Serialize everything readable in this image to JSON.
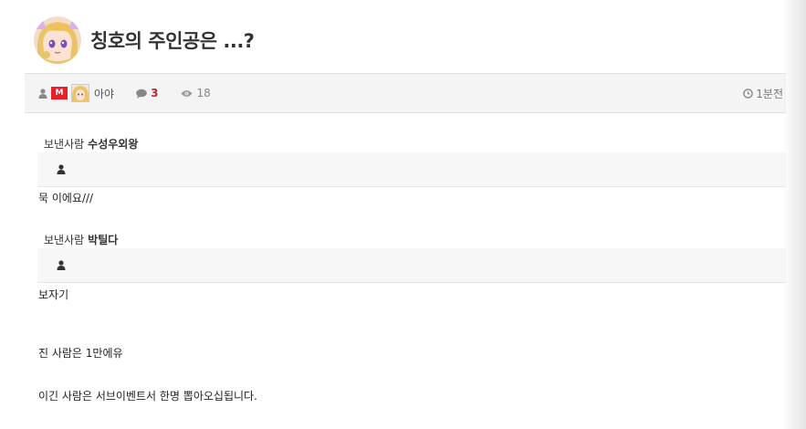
{
  "post": {
    "title": "칭호의 주인공은 ...?",
    "level_badge": "M",
    "author": "아야",
    "comment_count": "3",
    "view_count": "18",
    "time": "1분전"
  },
  "messages": [
    {
      "sender_label": "보낸사람",
      "sender_name": "수성우외왕",
      "body": "묵 이에요///"
    },
    {
      "sender_label": "보낸사람",
      "sender_name": "박틸다",
      "body": "보자기"
    }
  ],
  "closing": {
    "line1": "진 사람은 1만에유",
    "line2": "이긴 사람은 서브이벤트서 한명 뽑아오십됩니다."
  },
  "icons": {
    "user": "user-icon",
    "comment": "comment-icon",
    "view": "eye-icon",
    "time": "clock-icon"
  },
  "colors": {
    "badge": "#e8202a",
    "comment_count": "#c0262e",
    "meta_bg": "#f4f4f4"
  }
}
